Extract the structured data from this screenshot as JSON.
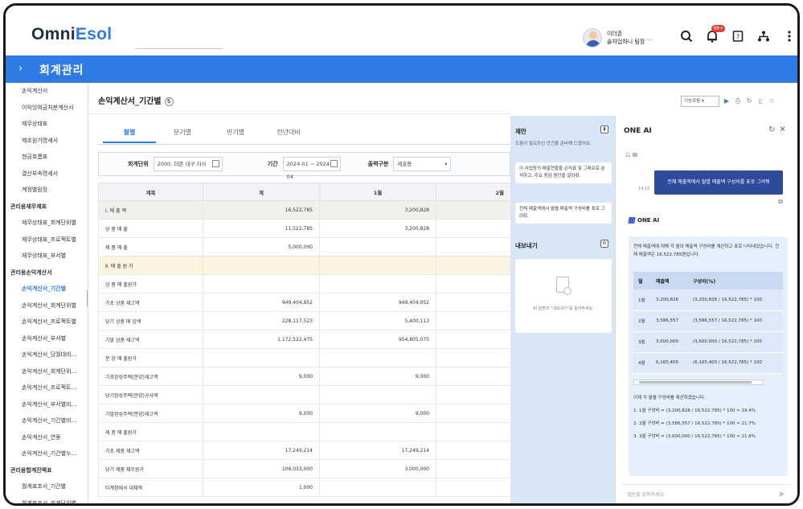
{
  "app": {
    "logo_main": "Omni",
    "logo_accent": "Esol"
  },
  "user": {
    "name": "이더존",
    "dept": "솔자업하니 팀장"
  },
  "top_icons": {
    "badge": "99+"
  },
  "nav": {
    "title": "회계관리"
  },
  "sidebar": {
    "items": [
      {
        "label": "손익계산서",
        "level": 1
      },
      {
        "label": "이익잉여금처분계산서",
        "level": 1
      },
      {
        "label": "재무상태표",
        "level": 1
      },
      {
        "label": "제조원가명세서",
        "level": 1
      },
      {
        "label": "현금흐름표",
        "level": 1
      },
      {
        "label": "결산부속명세서",
        "level": 1
      },
      {
        "label": "계정별원장",
        "level": 1
      },
      {
        "label": "관리용재무제표",
        "level": 0
      },
      {
        "label": "재무상태표_회계단위별",
        "level": 1
      },
      {
        "label": "재무상태표_프로젝트별",
        "level": 1
      },
      {
        "label": "재무상태표_부서별",
        "level": 1
      },
      {
        "label": "관리용손익계산서",
        "level": 0
      },
      {
        "label": "손익계산서_기간별",
        "level": 1,
        "active": true
      },
      {
        "label": "손익계산서_회계단위별",
        "level": 1
      },
      {
        "label": "손익계산서_프로젝트별",
        "level": 1
      },
      {
        "label": "손익계산서_부서별",
        "level": 1
      },
      {
        "label": "손익계산서_당월대비…",
        "level": 1
      },
      {
        "label": "손익계산서_회계단위…",
        "level": 1
      },
      {
        "label": "손익계산서_프로젝트…",
        "level": 1
      },
      {
        "label": "손익계산서_부서별비…",
        "level": 1
      },
      {
        "label": "손익계산서_기간별비…",
        "level": 1
      },
      {
        "label": "손익계산서_연동",
        "level": 1
      },
      {
        "label": "손익계산서_기간별누…",
        "level": 1
      },
      {
        "label": "관리용합계잔액표",
        "level": 0
      },
      {
        "label": "월계표조서_기간별",
        "level": 1
      },
      {
        "label": "월계표조서_회계단위별",
        "level": 1
      }
    ]
  },
  "main": {
    "title": "손익계산서_기간별",
    "tabs": [
      "월별",
      "분기별",
      "반기별",
      "전년대비"
    ],
    "filter": {
      "unit_label": "회계단위",
      "unit_value": "2000. 더존 대구 지사",
      "period_label": "기간",
      "period_value": "2024-01 ~ 2024-04",
      "type_label": "출력구분",
      "type_value": "제출용"
    },
    "table": {
      "headers": [
        "계목",
        "계",
        "1월",
        "2월"
      ],
      "rows": [
        {
          "name": "Ⅰ. 매  출  액",
          "total": "16,522,785",
          "m1": "3,200,828",
          "m2": "",
          "style": "gray"
        },
        {
          "name": "상  품  매  출",
          "total": "11,522,785",
          "m1": "3,200,828",
          "m2": ""
        },
        {
          "name": "제  품  매  출",
          "total": "5,000,000",
          "m1": "",
          "m2": ""
        },
        {
          "name": "Ⅱ. 매 출 원 가",
          "total": "",
          "m1": "",
          "m2": "",
          "style": "yellow"
        },
        {
          "name": "상 품 매 출원가",
          "total": "",
          "m1": "",
          "m2": ""
        },
        {
          "name": "기초 상품 재고액",
          "total": "949,404,952",
          "m1": "949,404,952",
          "m2": ""
        },
        {
          "name": "당기 상품 매 입액",
          "total": "228,117,523",
          "m1": "5,400,113",
          "m2": ""
        },
        {
          "name": "기말 상품 재고액",
          "total": "1,172,522,475",
          "m1": "954,805,075",
          "m2": ""
        },
        {
          "name": "분 양 매 출원가",
          "total": "",
          "m1": "",
          "m2": ""
        },
        {
          "name": "기초완성주택(분양)재고액",
          "total": "9,000",
          "m1": "9,000",
          "m2": ""
        },
        {
          "name": "당기완성주택(분양)공사액",
          "total": "",
          "m1": "",
          "m2": ""
        },
        {
          "name": "기말완성주택(분양)재고액",
          "total": "9,000",
          "m1": "9,000",
          "m2": ""
        },
        {
          "name": "제 품 매 출원가",
          "total": "",
          "m1": "",
          "m2": ""
        },
        {
          "name": "기초 제품 재고액",
          "total": "17,249,214",
          "m1": "17,249,214",
          "m2": ""
        },
        {
          "name": "당기 제품 제조원가",
          "total": "106,033,000",
          "m1": "3,000,000",
          "m2": ""
        },
        {
          "name": "타계정에서 대체액",
          "total": "1,000",
          "m1": "",
          "m2": ""
        }
      ]
    }
  },
  "toolbar": {
    "select_label": "기능모음"
  },
  "side_panel": {
    "title": "제안",
    "subtitle": "도움이 필요하신 안건을 준비해 드렸어요.",
    "suggestions": [
      "이 사업장의 매출현황을 손익표 및 그래프로 분석하고, 주요 증감 원인을 알려줘.",
      "전체 매출액에서 월별 매출액 구성비를 표로 그려줘."
    ],
    "export_title": "내보내기",
    "export_empty": "AI 답변의 \"내보내기\"를 눌러주세요."
  },
  "ai": {
    "title": "ONE AI",
    "user_message": "전체 매출액에서 월별 매출액 구성비를 표로 그려줘",
    "time": "14:10",
    "bot_name": "ONE AI",
    "answer_intro": "전체 매출액에 대해 각 월의 매출액 구성비를 계산하고 표로 나타내었습니다. 전체 매출액은 16,522,785원입니다.",
    "answer_table": {
      "headers": [
        "월",
        "매출액",
        "구성비(%)"
      ],
      "rows": [
        [
          "1월",
          "3,200,828",
          "(3,200,828 / 16,522,785) * 100"
        ],
        [
          "2월",
          "3,586,557",
          "(3,586,557 / 16,522,785) * 100"
        ],
        [
          "3월",
          "3,600,000",
          "(3,600,000 / 16,522,785) * 100"
        ],
        [
          "4월",
          "6,165,400",
          "(6,165,400 / 16,522,785) * 100"
        ]
      ]
    },
    "answer_outro": "이제 각 월별 구성비를 계산하겠습니다.",
    "answer_list": [
      "1. 1월 구성비 = (3,200,828 / 16,522,785) * 100 ≈ 19.4%",
      "2. 2월 구성비 = (3,586,557 / 16,522,785) * 100 ≈ 21.7%",
      "3. 3월 구성비 = (3,600,000 / 16,522,785) * 100 ≈ 21.8%"
    ],
    "input_placeholder": "질문을 입력하세요."
  }
}
